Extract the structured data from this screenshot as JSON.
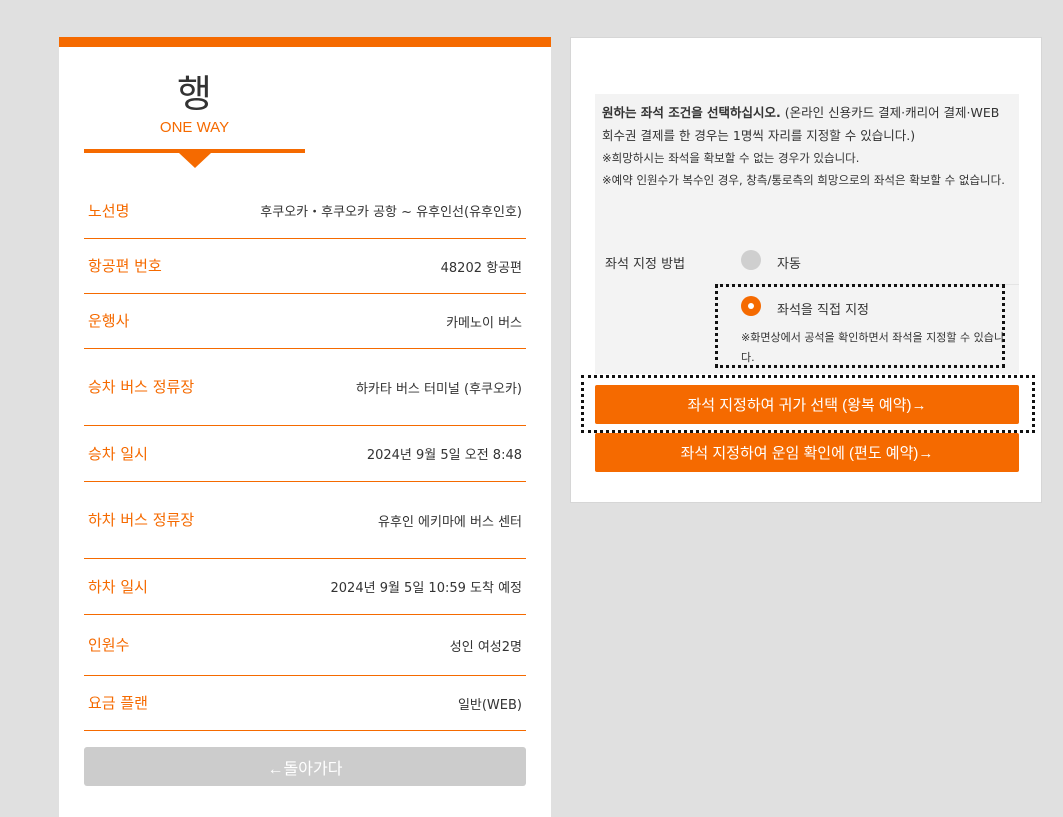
{
  "left": {
    "title_kanji": "행",
    "title_sub": "ONE WAY",
    "rows": [
      {
        "label": "노선명",
        "value": "후쿠오카・후쿠오카 공항 ~ 유후인선(유후인호)"
      },
      {
        "label": "항공편 번호",
        "value": "48202 항공편"
      },
      {
        "label": "운행사",
        "value": "카메노이 버스"
      },
      {
        "label": "승차 버스 정류장",
        "value": "하카타 버스 터미널 (후쿠오카)"
      },
      {
        "label": "승차 일시",
        "value": "2024년 9월 5일 오전 8:48"
      },
      {
        "label": "하차 버스 정류장",
        "value": "유후인 에키마에 버스 센터"
      },
      {
        "label": "하차 일시",
        "value": "2024년 9월 5일 10:59 도착 예정"
      },
      {
        "label": "인원수",
        "value": "성인 여성2명"
      },
      {
        "label": "요금 플랜",
        "value": "일반(WEB)"
      }
    ],
    "back_label": "←돌아가다"
  },
  "right": {
    "notice_strong": "원하는 좌석 조건을 선택하십시오.",
    "notice_rest": " (온라인 신용카드 결제·캐리어 결제·WEB 회수권 결제를 한 경우는 1명씩 자리를 지정할 수 있습니다.)",
    "notice_line2": "※희망하시는 좌석을 확보할 수 없는 경우가 있습니다.",
    "notice_line3": "※예약 인원수가 복수인 경우, 창측/통로측의 희망으로의 좌석은 확보할 수 없습니다.",
    "method_label": "좌석 지정 방법",
    "option_auto": "자동",
    "option_direct": "좌석을 직접 지정",
    "option_direct_note": "※화면상에서 공석을 확인하면서 좌석을 지정할 수 있습니다.",
    "button_roundtrip": "좌석 지정하여 귀가 선택 (왕복 예약)→",
    "button_oneway": "좌석 지정하여 운임 확인에 (편도 예약)→"
  },
  "colors": {
    "accent": "#f56a00",
    "background": "#e0e0e0",
    "disabled": "#cccccc"
  }
}
